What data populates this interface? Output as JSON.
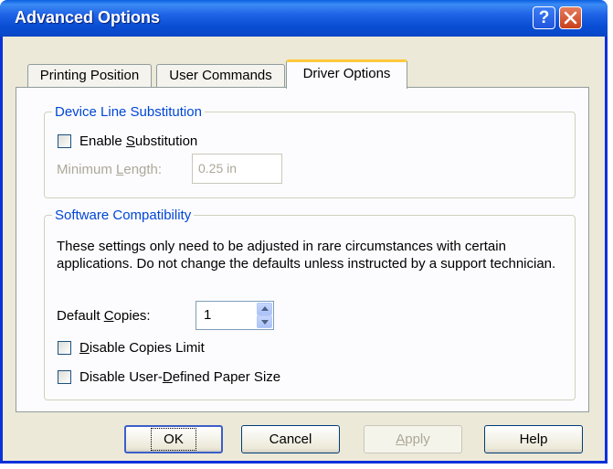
{
  "window": {
    "title": "Advanced Options",
    "help_glyph": "?"
  },
  "tabs": [
    {
      "label": "Printing Position",
      "active": false
    },
    {
      "label": "User Commands",
      "active": false
    },
    {
      "label": "Driver Options",
      "active": true
    }
  ],
  "device_line": {
    "legend": "Device Line Substitution",
    "enable_pre": "Enable ",
    "enable_accel": "S",
    "enable_post": "ubstitution",
    "enable_checked": false,
    "minlen_pre": "Minimum ",
    "minlen_accel": "L",
    "minlen_post": "ength:",
    "minlen_value": "0.25 in"
  },
  "software": {
    "legend": "Software Compatibility",
    "description": "These settings only need to be adjusted in rare circumstances with certain applications.  Do not change the defaults unless instructed by a support technician.",
    "copies_pre": "Default ",
    "copies_accel": "C",
    "copies_post": "opies:",
    "copies_value": "1",
    "limit_accel": "D",
    "limit_post": "isable Copies Limit",
    "limit_checked": false,
    "paper_pre": "Disable User-",
    "paper_accel": "D",
    "paper_post": "efined Paper Size",
    "paper_checked": false
  },
  "buttons": {
    "ok": "OK",
    "cancel": "Cancel",
    "apply_accel": "A",
    "apply_post": "pply",
    "help": "Help"
  },
  "colors": {
    "titlebar": "#0a4fd5",
    "group_legend": "#0046d5",
    "active_tab_accent": "#ffc83c"
  }
}
